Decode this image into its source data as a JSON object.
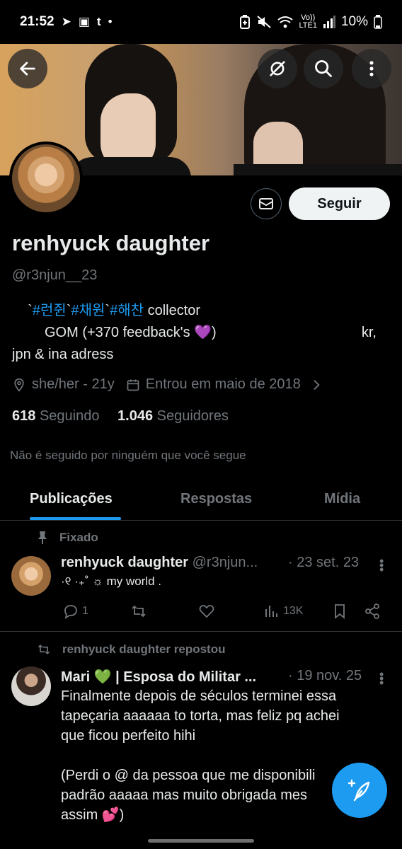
{
  "status_bar": {
    "time": "21:52",
    "telegram_glyph": "➤",
    "gallery_glyph": "▣",
    "tumblr_glyph": "t",
    "dot_glyph": "•",
    "volte_line1": "Vo))",
    "volte_line2": "LTE1",
    "battery": "10%"
  },
  "header": {
    "back_icon": "back-arrow-icon",
    "hide_icon": "eye-slash-icon",
    "search_icon": "search-icon",
    "more_icon": "more-vertical-icon"
  },
  "profile": {
    "name": "renhyuck daughter",
    "handle": "@r3njun__23",
    "follow_label": "Seguir",
    "bio_line1": {
      "prefix": "`",
      "tag1": "#런쥔",
      "sep1": "`",
      "tag2": "#채원",
      "sep2": "`",
      "tag3": "#해찬",
      "suffix": " collector"
    },
    "bio_line2": "GOM (+370 feedback's 💜)",
    "bio_line2_right": "kr,",
    "bio_line3": "jpn & ina adress",
    "location": "she/her - 21y",
    "joined": "Entrou em maio de 2018",
    "following_count": "618",
    "following_label": "Seguindo",
    "followers_count": "1.046",
    "followers_label": "Seguidores",
    "followed_by": "Não é seguido por ninguém que você segue"
  },
  "tabs": [
    {
      "label": "Publicações",
      "active": true
    },
    {
      "label": "Respostas",
      "active": false
    },
    {
      "label": "Mídia",
      "active": false
    }
  ],
  "posts": [
    {
      "context": "Fixado",
      "author": "renhyuck daughter",
      "handle": "@r3njun...",
      "time": "· 23 set. 23",
      "text": "·୧ ·₊˚ ☼ my world .",
      "replies": "1",
      "reposts": "",
      "likes": "",
      "views": "13K"
    },
    {
      "context": "renhyuck daughter repostou",
      "author": "Mari 💚 | Esposa do Militar ...",
      "time": "· 19 nov. 25",
      "text_lines": [
        "Finalmente depois de séculos terminei essa",
        "tapeçaria aaaaaa to torta, mas feliz pq achei",
        "que ficou perfeito hihi",
        "",
        "(Perdi o @ da pessoa que me disponibili",
        "padrão aaaaa mas muito obrigada mes",
        "assim 💕)"
      ]
    }
  ],
  "colors": {
    "accent": "#1d9bf0",
    "background": "#000000",
    "text_primary": "#e7e9ea",
    "text_secondary": "#71767b",
    "divider": "#2f3336"
  },
  "fab_icon": "compose-feather-icon"
}
